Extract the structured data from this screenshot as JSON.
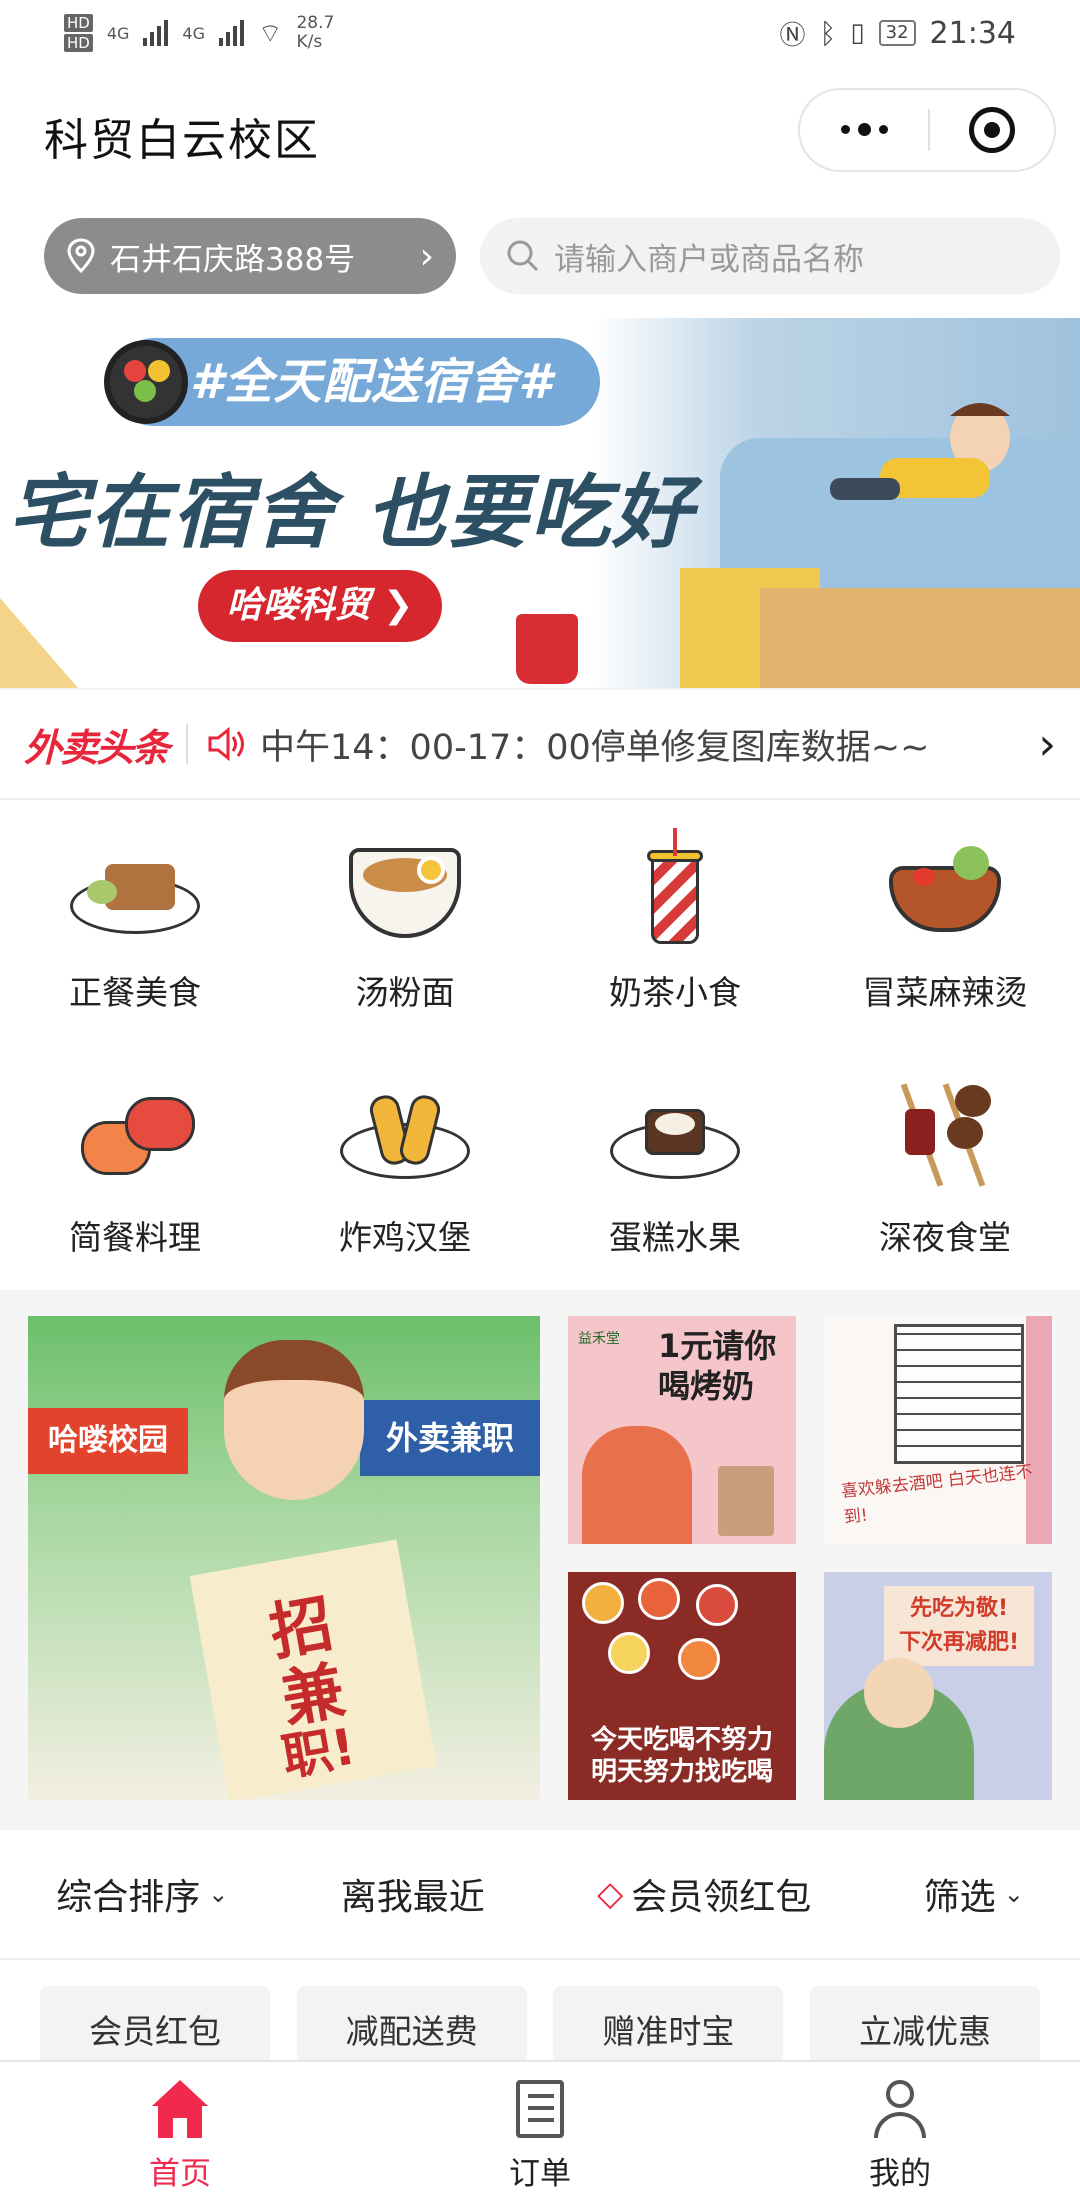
{
  "status_bar": {
    "hd1": "HD",
    "hd2": "HD",
    "net1": "4G",
    "net2": "4G",
    "speed_value": "28.7",
    "speed_unit": "K/s",
    "battery": "32",
    "time": "21:34"
  },
  "header": {
    "title": "科贸白云校区"
  },
  "location": {
    "address": "石井石庆路388号"
  },
  "search": {
    "placeholder": "请输入商户或商品名称"
  },
  "banner": {
    "tag": "#全天配送宿舍#",
    "headline": "宅在宿舍 也要吃好",
    "button": "哈喽科贸 ❯"
  },
  "news": {
    "logo": "外卖头条",
    "text": "中午14：00-17：00停单修复图库数据~~"
  },
  "categories": [
    {
      "label": "正餐美食"
    },
    {
      "label": "汤粉面"
    },
    {
      "label": "奶茶小食"
    },
    {
      "label": "冒菜麻辣烫"
    },
    {
      "label": "简餐料理"
    },
    {
      "label": "炸鸡汉堡"
    },
    {
      "label": "蛋糕水果"
    },
    {
      "label": "深夜食堂"
    }
  ],
  "promos": {
    "big": {
      "left_sign": "哈喽校园",
      "right_sign": "外卖兼职",
      "paper_1": "招",
      "paper_2": "兼",
      "paper_3": "职!"
    },
    "p1": {
      "brand": "益禾堂",
      "title": "1元请你喝烤奶"
    },
    "p2": {
      "caption": "喜欢躲去酒吧 白天也连不到!"
    },
    "p3": {
      "caption_1": "今天吃喝不努力",
      "caption_2": "明天努力找吃喝"
    },
    "p4": {
      "line_1": "先吃为敬!",
      "line_2": "下次再减肥!"
    }
  },
  "sort_bar": {
    "items": [
      {
        "label": "综合排序"
      },
      {
        "label": "离我最近"
      },
      {
        "label": "会员领红包"
      },
      {
        "label": "筛选"
      }
    ]
  },
  "tags": [
    {
      "label": "会员红包"
    },
    {
      "label": "减配送费"
    },
    {
      "label": "赠准时宝"
    },
    {
      "label": "立减优惠"
    }
  ],
  "tab_bar": {
    "tabs": [
      {
        "label": "首页",
        "active": true
      },
      {
        "label": "订单",
        "active": false
      },
      {
        "label": "我的",
        "active": false
      }
    ]
  },
  "colors": {
    "accent": "#f0294d",
    "location_bg": "#8c8c8c"
  }
}
